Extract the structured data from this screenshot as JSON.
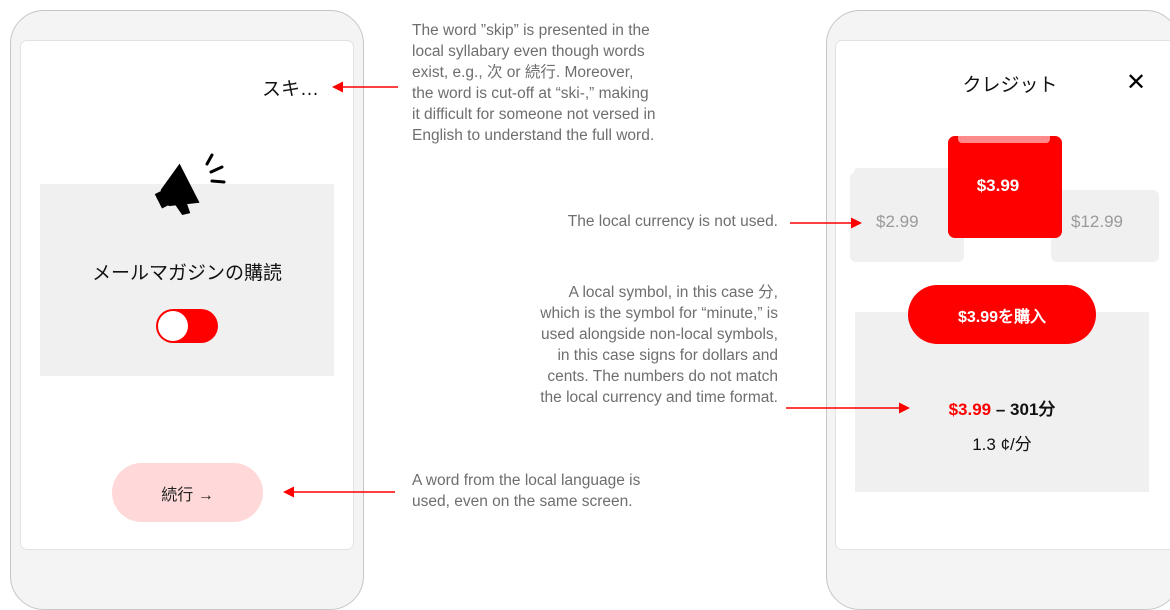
{
  "left_phone": {
    "skip_label": "スキ…",
    "feature_title": "メールマガジンの購読",
    "toggle_state": "on",
    "continue_label": "続行 →",
    "icons": [
      "megaphone-icon"
    ]
  },
  "right_phone": {
    "title": "クレジット",
    "close_label": "✕",
    "price_selected": "$3.99",
    "price_left": "$2.99",
    "price_right": "$12.99",
    "buy_button_label": "$3.99を購入",
    "summary_price": "$3.99",
    "summary_rest": " – 301分",
    "rate": "1.3 ¢/分"
  },
  "annotations": {
    "skip": [
      "The word ”skip” is presented in the",
      "local syllabary even though words",
      "exist, e.g., 次 or 続行. Moreover,",
      "the word is cut-off at “ski-,” making",
      "it difficult for someone not versed in",
      "English to understand the full word."
    ],
    "currency": "The local currency is not used.",
    "symbol": [
      "A local symbol, in this case 分,",
      "which is the symbol for “minute,” is",
      "used alongside non-local symbols,",
      "in this case signs for dollars and",
      "cents. The numbers do not match",
      "the local currency and time format."
    ],
    "language": [
      "A word from the local language is",
      "used, even on the same screen."
    ]
  },
  "colors": {
    "accent": "#ff0000",
    "pale_accent": "#ffd9d9",
    "card_gray": "#f0f0f0",
    "annotation_text": "#6e6e6e"
  }
}
